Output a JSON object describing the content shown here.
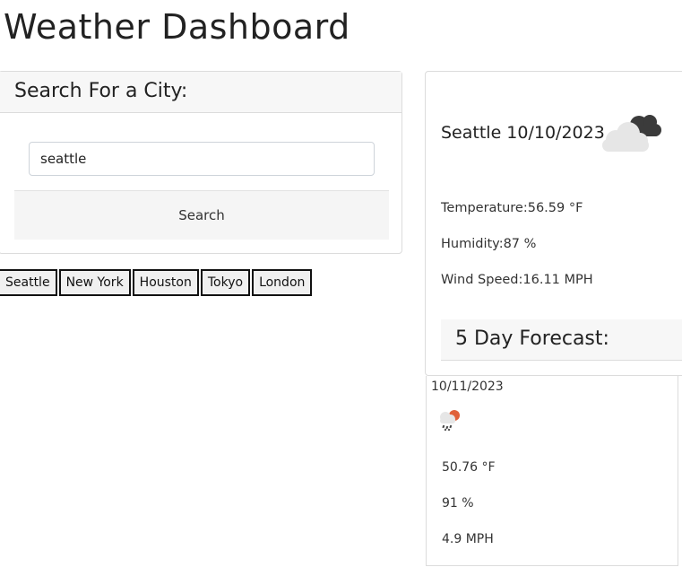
{
  "header": {
    "title": "Weather Dashboard"
  },
  "search": {
    "heading": "Search For a City:",
    "input_value": "seattle",
    "button_label": "Search"
  },
  "history": [
    "Seattle",
    "New York",
    "Houston",
    "Tokyo",
    "London"
  ],
  "current": {
    "city_date": "Seattle 10/10/2023",
    "icon": "cloud-icon",
    "temperature": "Temperature:56.59 °F",
    "humidity": "Humidity:87 %",
    "wind": "Wind Speed:16.11 MPH"
  },
  "forecast": {
    "heading": "5 Day Forecast:",
    "days": [
      {
        "date": "10/11/2023",
        "icon": "rain-sun-icon",
        "temp": "50.76 °F",
        "humidity": "91 %",
        "wind": "4.9 MPH"
      }
    ]
  },
  "colors": {
    "icon_dark": "#3b3b3b",
    "icon_light": "#e6e6e6",
    "sun": "#e0613a"
  }
}
